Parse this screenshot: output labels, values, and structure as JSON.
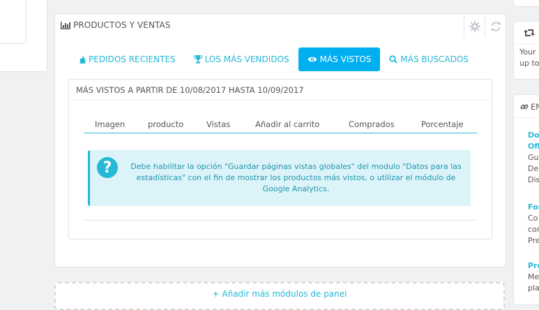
{
  "panel": {
    "title": "PRODUCTOS Y VENTAS",
    "tools": [
      {
        "name": "gear-icon"
      },
      {
        "name": "refresh-icon"
      }
    ]
  },
  "tabs": [
    {
      "label": "PEDIDOS RECIENTES",
      "icon": "fire-icon",
      "active": false
    },
    {
      "label": "LOS MÁS VENDIDOS",
      "icon": "trophy-icon",
      "active": false
    },
    {
      "label": "MÁS VISTOS",
      "icon": "eye-icon",
      "active": true
    },
    {
      "label": "MÁS BUSCADOS",
      "icon": "search-icon",
      "active": false
    }
  ],
  "section": {
    "heading": "MÁS VISTOS A PARTIR DE 10/08/2017 HASTA 10/09/2017",
    "columns": [
      "Imagen",
      "producto",
      "Vistas",
      "Añadir al carrito",
      "Comprados",
      "Porcentaje"
    ]
  },
  "alert": {
    "icon": "question-icon",
    "icon_glyph": "?",
    "text": "Debe habilitar la opción \"Guardar páginas vistas globales\" del modulo \"Datos para las estadísticas\" con el fin de mostrar los productos más vistos, o utilizar el módulo de Google Analytics."
  },
  "dashed_add": {
    "text": "+ Añadir más módulos de panel"
  },
  "right_column": {
    "card2_heading_icon": "retweet-icon",
    "card2_lines": [
      "Your",
      "up to"
    ],
    "card3_heading": "EN",
    "card3_heading_icon": "link-icon",
    "card3_items": [
      {
        "title_lines": [
          "Do",
          "Ofi"
        ],
        "body_lines": [
          "Gu",
          "De",
          "Dis"
        ]
      },
      {
        "title_lines": [
          "For"
        ],
        "body_lines": [
          "Co",
          "cor",
          "Pre"
        ]
      },
      {
        "title_lines": [
          "Pre"
        ],
        "body_lines": [
          "Me",
          "pla"
        ]
      }
    ]
  },
  "colors": {
    "accent": "#25b9d7",
    "active_tab": "#00aff0",
    "alert_bg": "#dcf4f9",
    "page_bg": "#eff1f2"
  }
}
